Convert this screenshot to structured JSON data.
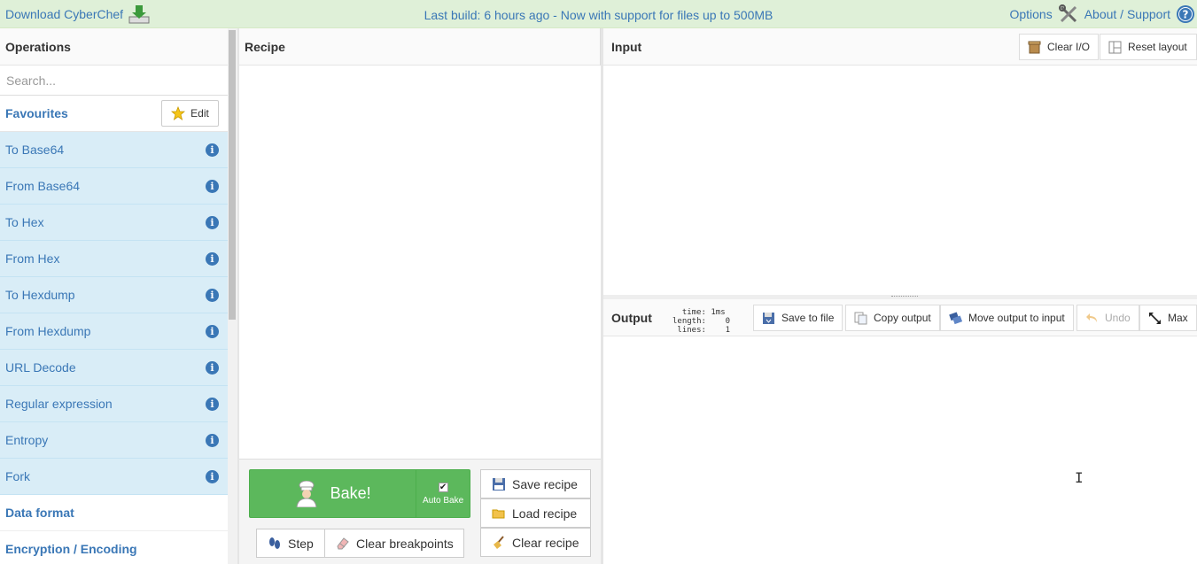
{
  "banner": {
    "download_label": "Download CyberChef",
    "notice": "Last build: 6 hours ago - Now with support for files up to 500MB",
    "options_label": "Options",
    "about_label": "About / Support"
  },
  "operations": {
    "title": "Operations",
    "search_placeholder": "Search...",
    "favourites_label": "Favourites",
    "edit_label": "Edit",
    "items": [
      {
        "label": "To Base64"
      },
      {
        "label": "From Base64"
      },
      {
        "label": "To Hex"
      },
      {
        "label": "From Hex"
      },
      {
        "label": "To Hexdump"
      },
      {
        "label": "From Hexdump"
      },
      {
        "label": "URL Decode"
      },
      {
        "label": "Regular expression"
      },
      {
        "label": "Entropy"
      },
      {
        "label": "Fork"
      }
    ],
    "categories": [
      "Data format",
      "Encryption / Encoding"
    ]
  },
  "recipe": {
    "title": "Recipe",
    "bake_label": "Bake!",
    "auto_bake_label": "Auto Bake",
    "auto_bake_checked": true,
    "step_label": "Step",
    "clear_breakpoints_label": "Clear breakpoints",
    "save_label": "Save recipe",
    "load_label": "Load recipe",
    "clear_label": "Clear recipe"
  },
  "input": {
    "title": "Input",
    "clear_io_label": "Clear I/O",
    "reset_layout_label": "Reset layout"
  },
  "output": {
    "title": "Output",
    "stats": {
      "time": "1ms",
      "length": "0",
      "lines": "1"
    },
    "save_to_file_label": "Save to file",
    "copy_output_label": "Copy output",
    "move_output_label": "Move output to input",
    "undo_label": "Undo",
    "max_label": "Max"
  },
  "colors": {
    "banner_bg": "#dff0d8",
    "link": "#3a77b6",
    "favourite_bg": "#d9edf7",
    "bake_green": "#5cb85c"
  }
}
